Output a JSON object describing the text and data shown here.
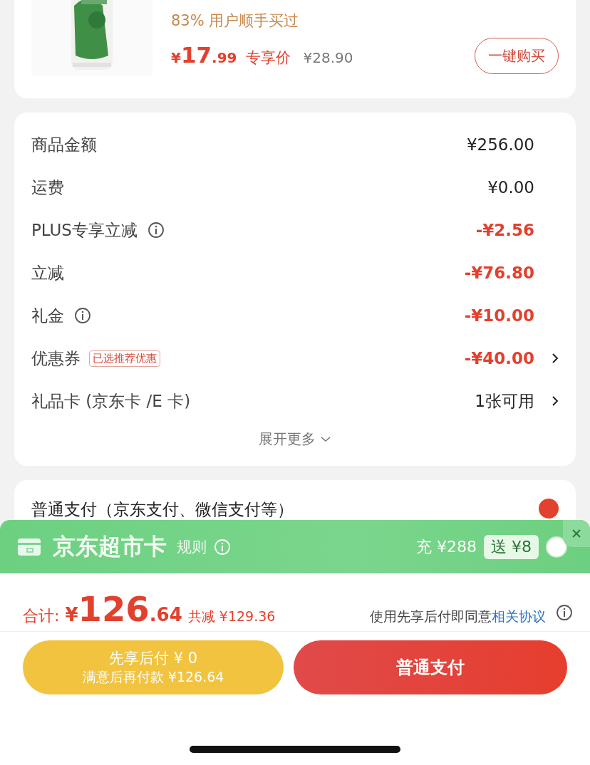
{
  "product": {
    "bought_note": "83% 用户顺手买过",
    "price_currency": "¥",
    "price_int": "17",
    "price_dec": ".99",
    "price_label": "专享价",
    "original_price": "¥28.90",
    "buy_button": "一键购买"
  },
  "summary": {
    "rows": [
      {
        "label": "商品金额",
        "info": false,
        "tag": "",
        "value": "¥256.00",
        "discount": false,
        "arrow": false
      },
      {
        "label": "运费",
        "info": false,
        "tag": "",
        "value": "¥0.00",
        "discount": false,
        "arrow": false
      },
      {
        "label": "PLUS专享立减",
        "info": true,
        "tag": "",
        "value": "-¥2.56",
        "discount": true,
        "arrow": false
      },
      {
        "label": "立减",
        "info": false,
        "tag": "",
        "value": "-¥76.80",
        "discount": true,
        "arrow": false
      },
      {
        "label": "礼金",
        "info": true,
        "tag": "",
        "value": "-¥10.00",
        "discount": true,
        "arrow": false
      },
      {
        "label": "优惠券",
        "info": false,
        "tag": "已选推荐优惠",
        "value": "-¥40.00",
        "discount": true,
        "arrow": true
      },
      {
        "label": "礼品卡 (京东卡 /E 卡)",
        "info": false,
        "tag": "",
        "value": "1张可用",
        "discount": false,
        "arrow": true
      }
    ],
    "expand": "展开更多"
  },
  "payment_option": {
    "label": "普通支付（京东支付、微信支付等）",
    "selected": true
  },
  "card_banner": {
    "title": "京东超市卡",
    "rules": "规则",
    "recharge": "充 ¥288",
    "bonus": "送 ¥8",
    "checked": false
  },
  "total": {
    "label": "合计:",
    "currency": "¥",
    "amount_int": "126",
    "amount_dec": ".64",
    "saved": "共减 ¥129.36",
    "agreement": "使用先享后付即同意",
    "agreement_link": "相关协议"
  },
  "buttons": {
    "later_title": "先享后付 ¥ 0",
    "later_sub": "满意后再付款 ¥126.64",
    "pay": "普通支付"
  }
}
